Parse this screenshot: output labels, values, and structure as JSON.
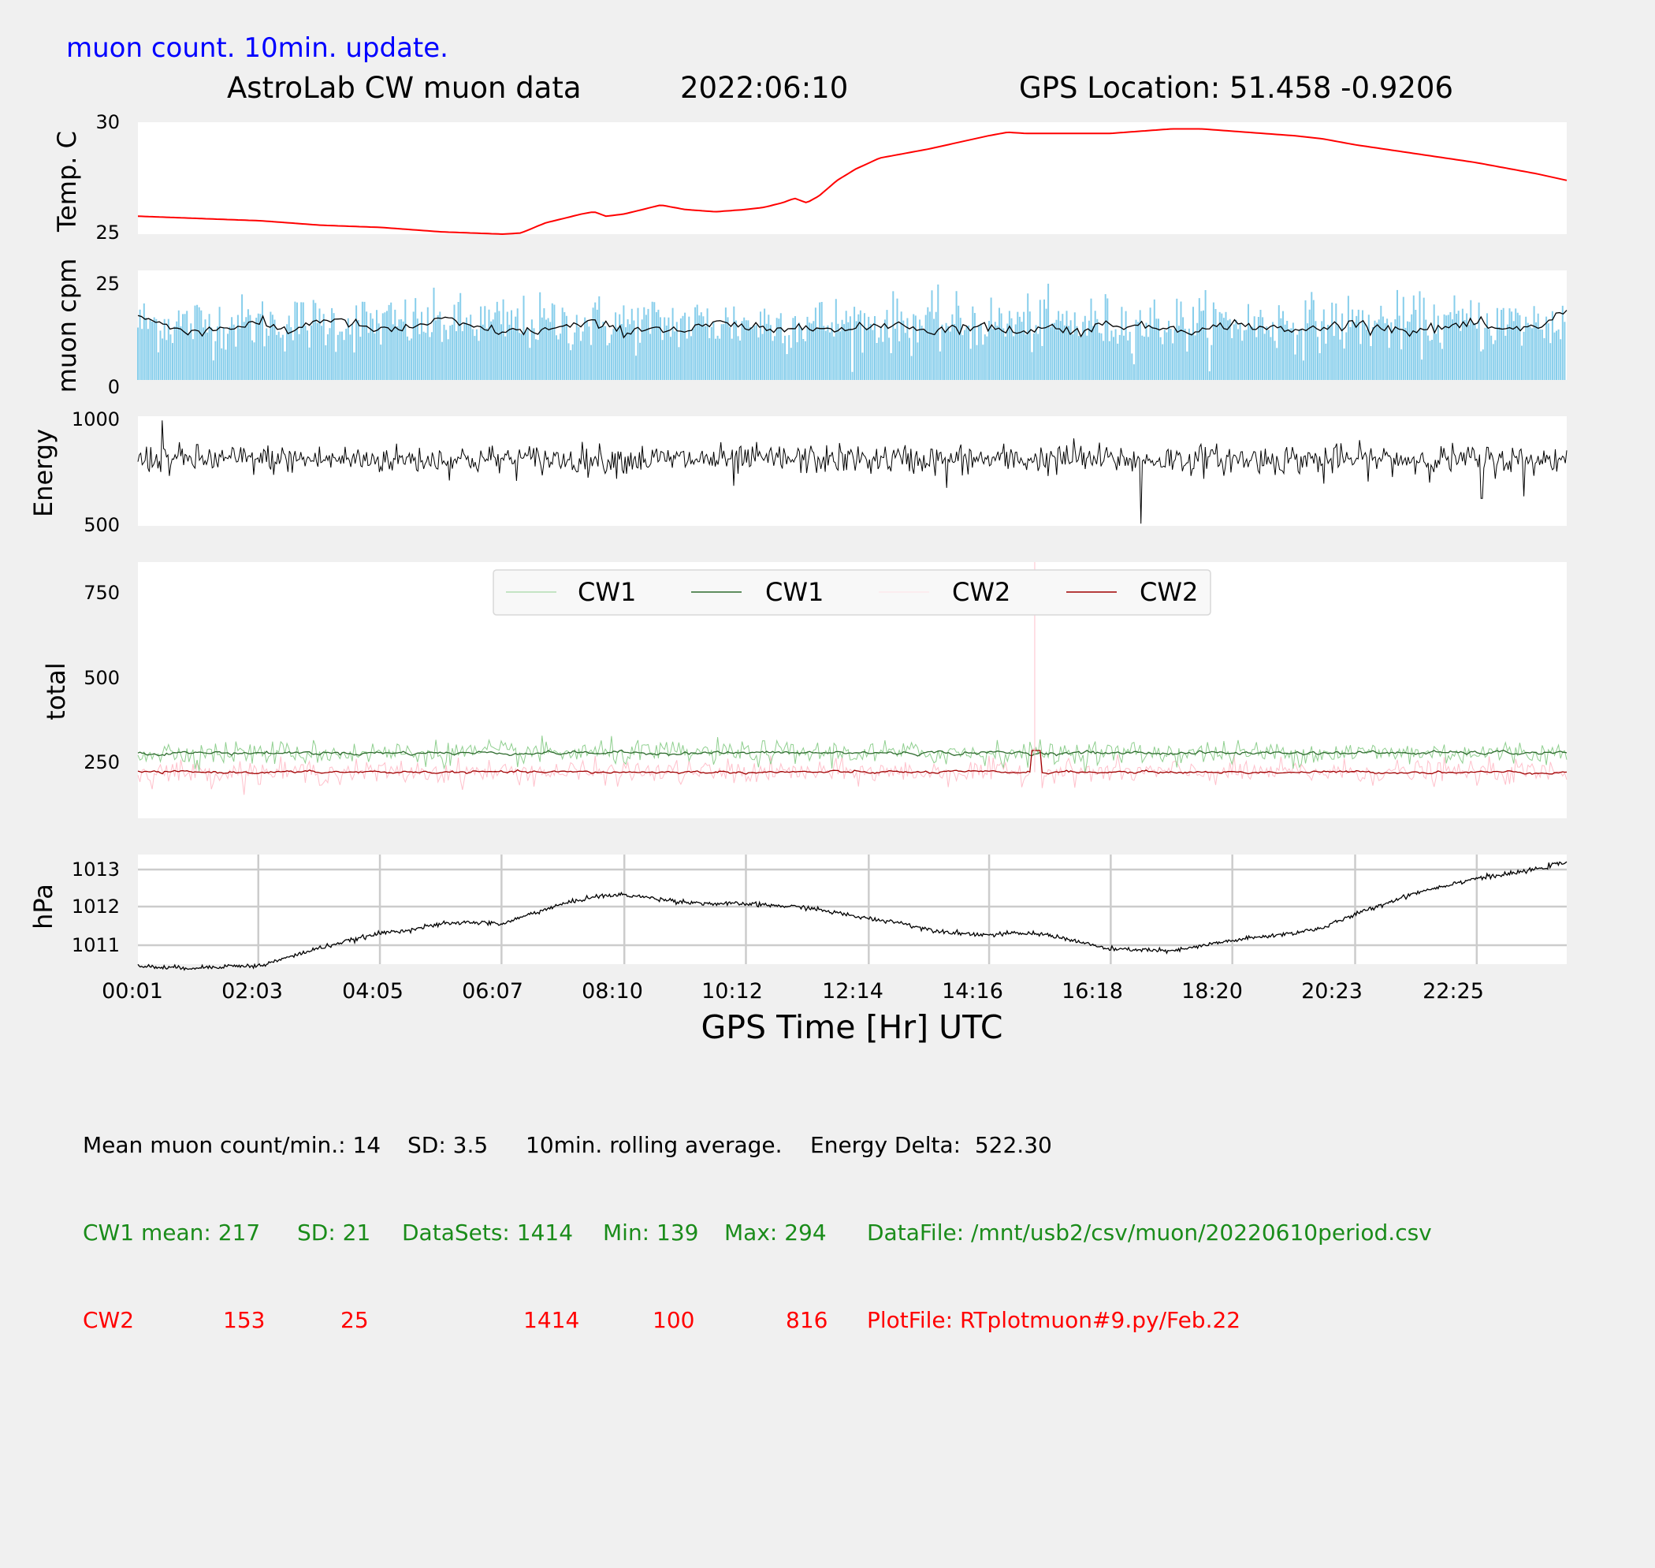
{
  "header": {
    "subtitle": "muon count.  10min. update.",
    "title": "AstroLab CW muon data",
    "date": "2022:06:10",
    "location": "GPS Location: 51.458   -0.9206"
  },
  "colors": {
    "temp": "#ff0000",
    "muon_bars": "#87ceeb",
    "rolling_avg": "#000000",
    "cw1_raw": "#8fcf8f",
    "cw1_avg": "#2e6b2e",
    "cw2_raw": "#ffc0cb",
    "cw2_avg": "#a00000",
    "subtitle": "#0000ff",
    "grid": "#cccccc"
  },
  "chart_data": [
    {
      "id": "temp",
      "type": "line",
      "ylabel": "Temp. C",
      "ylim": [
        25,
        30
      ],
      "yticks": [
        "25",
        "30"
      ],
      "xlim": [
        0,
        23.5
      ],
      "grid": false,
      "series": [
        {
          "x": [
            0.0,
            1.0,
            2.0,
            3.0,
            4.0,
            5.0,
            5.5,
            6.0,
            6.3,
            6.7,
            7.0,
            7.3,
            7.5,
            7.7,
            8.0,
            8.3,
            8.6,
            9.0,
            9.5,
            10.0,
            10.3,
            10.6,
            10.8,
            11.0,
            11.2,
            11.5,
            11.8,
            12.2,
            12.6,
            13.0,
            13.5,
            14.0,
            14.3,
            14.6,
            15.0,
            15.5,
            16.0,
            16.5,
            17.0,
            17.5,
            18.0,
            18.5,
            19.0,
            19.5,
            20.0,
            20.5,
            21.0,
            22.0,
            23.0,
            23.5
          ],
          "y": [
            25.8,
            25.7,
            25.6,
            25.4,
            25.3,
            25.1,
            25.05,
            25.0,
            25.05,
            25.5,
            25.7,
            25.9,
            26.0,
            25.8,
            25.9,
            26.1,
            26.3,
            26.1,
            26.0,
            26.1,
            26.2,
            26.4,
            26.6,
            26.4,
            26.7,
            27.4,
            27.9,
            28.4,
            28.6,
            28.8,
            29.1,
            29.4,
            29.55,
            29.5,
            29.5,
            29.5,
            29.5,
            29.6,
            29.7,
            29.7,
            29.6,
            29.5,
            29.4,
            29.25,
            29.0,
            28.8,
            28.6,
            28.2,
            27.7,
            27.4
          ]
        }
      ]
    },
    {
      "id": "muon",
      "type": "bar",
      "ylabel": "muon cpm",
      "ylim": [
        0,
        27
      ],
      "yticks": [
        "0",
        "25"
      ],
      "xlim": [
        0,
        23.5
      ],
      "grid": false,
      "bar_mean": 14,
      "bar_sd": 3.5,
      "series": [
        {
          "name": "10min. rolling average",
          "x": [
            0.0,
            0.5,
            1.0,
            1.5,
            2.0,
            2.5,
            3.0,
            3.5,
            4.0,
            4.5,
            5.0,
            5.5,
            6.0,
            6.5,
            7.0,
            7.5,
            8.0,
            8.5,
            9.0,
            9.5,
            10.0,
            10.5,
            11.0,
            11.5,
            12.0,
            12.5,
            13.0,
            13.5,
            14.0,
            14.5,
            15.0,
            15.5,
            16.0,
            16.5,
            17.0,
            17.5,
            18.0,
            18.5,
            19.0,
            19.5,
            20.0,
            20.5,
            21.0,
            21.5,
            22.0,
            22.5,
            23.0,
            23.5
          ],
          "y": [
            16,
            13,
            12,
            13,
            14,
            12,
            15,
            14,
            12,
            13,
            15,
            13,
            12,
            12,
            13,
            14,
            12,
            13,
            12,
            14,
            13,
            12,
            14,
            12,
            13,
            14,
            12,
            13,
            13,
            12,
            13,
            12,
            14,
            13,
            13,
            12,
            14,
            13,
            12,
            13,
            14,
            13,
            12,
            13,
            14,
            12,
            13,
            17
          ]
        }
      ]
    },
    {
      "id": "energy",
      "type": "line",
      "ylabel": "Energy",
      "ylim": [
        500,
        1020
      ],
      "yticks": [
        "500",
        "1000"
      ],
      "xlim": [
        0,
        23.5
      ],
      "grid": false,
      "base": 815,
      "spikes": [
        {
          "x": 0.4,
          "y": 1000
        },
        {
          "x": 9.8,
          "y": 690
        },
        {
          "x": 13.3,
          "y": 680
        },
        {
          "x": 15.4,
          "y": 915
        },
        {
          "x": 16.5,
          "y": 510
        },
        {
          "x": 19.5,
          "y": 700
        },
        {
          "x": 22.1,
          "y": 630
        },
        {
          "x": 22.8,
          "y": 640
        }
      ]
    },
    {
      "id": "total",
      "type": "line",
      "ylabel": "total",
      "ylim": [
        0,
        850
      ],
      "yticks": [
        "250",
        "500",
        "750"
      ],
      "xlim": [
        0,
        23.5
      ],
      "grid": false,
      "legend": {
        "position": "top-center",
        "entries": [
          "CW1",
          "CW1",
          "CW2",
          "CW2"
        ]
      },
      "cw1_mean": 217,
      "cw2_mean": 153,
      "cw2_spike": {
        "x": 14.75,
        "y": 850
      },
      "cw2_step": {
        "x": [
          14.7,
          14.85
        ],
        "y": 225
      }
    },
    {
      "id": "pressure",
      "type": "line",
      "ylabel": "hPa",
      "ylim": [
        1010.6,
        1013.6
      ],
      "yticks": [
        "1011",
        "1012",
        "1013"
      ],
      "xlim": [
        0,
        23.5
      ],
      "grid": true,
      "xticks": [
        "00:01",
        "02:03",
        "04:05",
        "06:07",
        "08:10",
        "10:12",
        "12:14",
        "14:16",
        "16:18",
        "18:20",
        "20:23",
        "22:25"
      ],
      "xlabel": "GPS Time  [Hr] UTC",
      "series": [
        {
          "x": [
            0.0,
            0.5,
            1.0,
            1.5,
            2.0,
            2.5,
            3.0,
            3.5,
            4.0,
            4.5,
            5.0,
            5.5,
            6.0,
            6.5,
            7.0,
            7.5,
            8.0,
            8.5,
            9.0,
            9.5,
            10.0,
            10.5,
            11.0,
            11.5,
            12.0,
            12.5,
            13.0,
            13.5,
            14.0,
            14.5,
            15.0,
            15.5,
            16.0,
            16.5,
            17.0,
            17.5,
            18.0,
            18.5,
            19.0,
            19.5,
            20.0,
            20.5,
            21.0,
            21.5,
            22.0,
            22.5,
            23.0,
            23.5
          ],
          "y": [
            1010.55,
            1010.5,
            1010.5,
            1010.55,
            1010.55,
            1010.8,
            1011.05,
            1011.25,
            1011.45,
            1011.55,
            1011.7,
            1011.75,
            1011.7,
            1012.0,
            1012.25,
            1012.45,
            1012.5,
            1012.4,
            1012.3,
            1012.25,
            1012.25,
            1012.2,
            1012.15,
            1012.0,
            1011.85,
            1011.75,
            1011.55,
            1011.45,
            1011.4,
            1011.45,
            1011.4,
            1011.2,
            1011.0,
            1011.0,
            1010.95,
            1011.1,
            1011.25,
            1011.35,
            1011.45,
            1011.6,
            1011.95,
            1012.25,
            1012.55,
            1012.75,
            1012.95,
            1013.05,
            1013.2,
            1013.4
          ]
        }
      ]
    }
  ],
  "stats": {
    "line1": {
      "mean_label": "Mean muon count/min.: 14",
      "sd_label": "SD: 3.5",
      "avg_label": "10min. rolling average.",
      "energy_label": "Energy Delta:  522.30"
    },
    "cw1": {
      "name": "CW1 mean: 217",
      "sd": "SD: 21",
      "datasets": "DataSets: 1414",
      "min": "Min: 139",
      "max": "Max: 294",
      "file": "DataFile: /mnt/usb2/csv/muon/20220610period.csv"
    },
    "cw2": {
      "name": "CW2",
      "mean": "153",
      "sd": "25",
      "datasets": "1414",
      "min": "100",
      "max": "816",
      "file": "PlotFile: RTplotmuon#9.py/Feb.22"
    }
  }
}
